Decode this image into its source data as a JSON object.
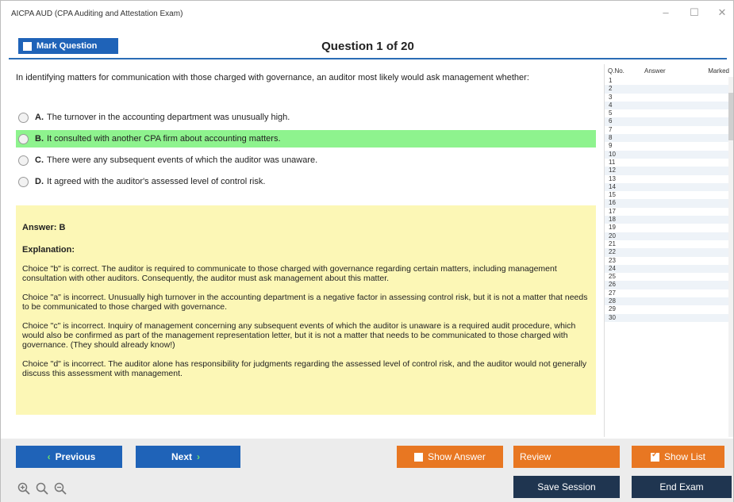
{
  "window": {
    "title": "AICPA AUD (CPA Auditing and Attestation Exam)"
  },
  "header": {
    "mark_label": "Mark Question",
    "question_title": "Question 1 of 20"
  },
  "question": {
    "text": "In identifying matters for communication with those charged with governance, an auditor most likely would ask management whether:",
    "options": [
      {
        "letter": "A.",
        "text": "The turnover in the accounting department was unusually high."
      },
      {
        "letter": "B.",
        "text": "It consulted with another CPA firm about accounting matters."
      },
      {
        "letter": "C.",
        "text": "There were any subsequent events of which the auditor was unaware."
      },
      {
        "letter": "D.",
        "text": "It agreed with the auditor's assessed level of control risk."
      }
    ],
    "correct_index": 1
  },
  "explanation": {
    "answer": "Answer: B",
    "heading": "Explanation:",
    "paragraphs": [
      "Choice \"b\" is correct. The auditor is required to communicate to those charged with governance regarding certain matters, including management consultation with other auditors. Consequently, the auditor must ask management about this matter.",
      "Choice \"a\" is incorrect. Unusually high turnover in the accounting department is a negative factor in assessing control risk, but it is not a matter that needs to be communicated to those charged with governance.",
      "Choice \"c\" is incorrect. Inquiry of management concerning any subsequent events of which the auditor is unaware is a required audit procedure, which would also be confirmed as part of the management representation letter, but it is not a matter that needs to be communicated to those charged with governance. (They should already know!)",
      "Choice \"d\" is incorrect. The auditor alone has responsibility for judgments regarding the assessed level of control risk, and the auditor would not generally discuss this assessment with management."
    ]
  },
  "qlist": {
    "headers": {
      "qno": "Q.No.",
      "answer": "Answer",
      "marked": "Marked"
    },
    "rows": [
      "1",
      "2",
      "3",
      "4",
      "5",
      "6",
      "7",
      "8",
      "9",
      "10",
      "11",
      "12",
      "13",
      "14",
      "15",
      "16",
      "17",
      "18",
      "19",
      "20",
      "21",
      "22",
      "23",
      "24",
      "25",
      "26",
      "27",
      "28",
      "29",
      "30"
    ]
  },
  "footer": {
    "previous": "Previous",
    "next": "Next",
    "show_answer": "Show Answer",
    "review": "Review",
    "show_list": "Show List",
    "save_session": "Save Session",
    "end_exam": "End Exam"
  },
  "colors": {
    "primary_blue": "#1f63b8",
    "orange": "#e87722",
    "navy": "#1f3550",
    "correct_green": "#8ef38e",
    "explain_bg": "#fcf7b6"
  },
  "icons": [
    "zoom-in-icon",
    "zoom-reset-icon",
    "zoom-out-icon",
    "minimize-icon",
    "maximize-icon",
    "close-icon"
  ]
}
